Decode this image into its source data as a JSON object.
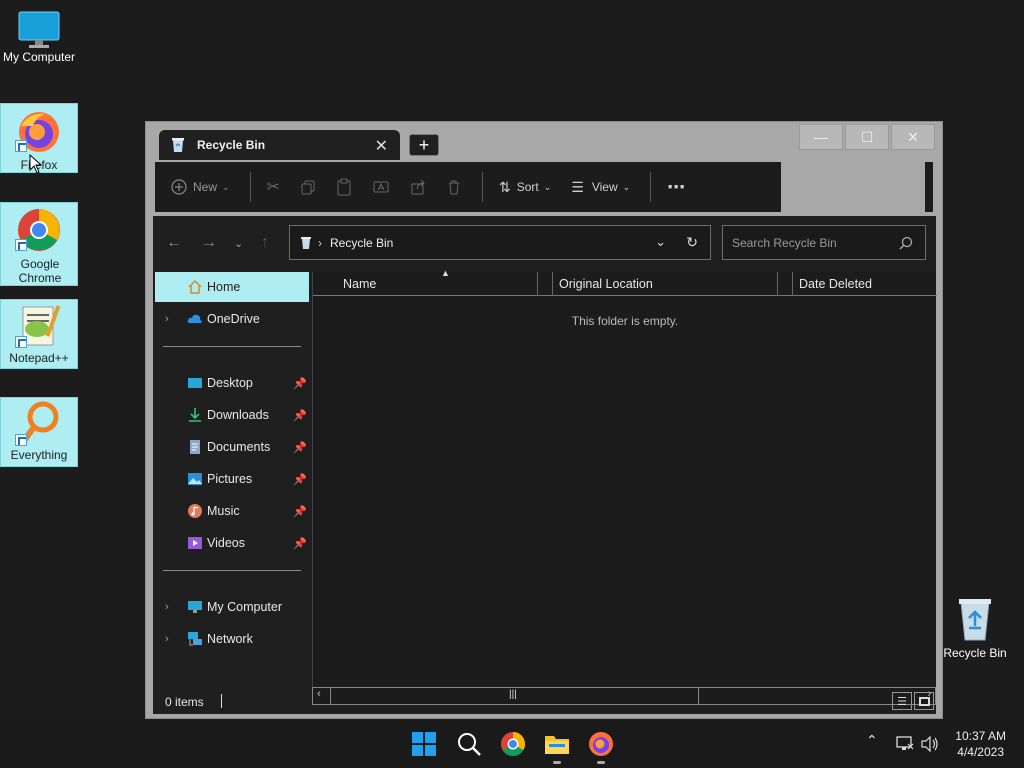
{
  "desktop": {
    "icons": [
      {
        "label": "My Computer"
      },
      {
        "label": "Firefox"
      },
      {
        "label": "Google Chrome"
      },
      {
        "label": "Notepad++"
      },
      {
        "label": "Everything"
      },
      {
        "label": "Recycle Bin"
      }
    ]
  },
  "window": {
    "tab_title": "Recycle Bin",
    "new_tab_label": "+",
    "close_tab_label": "✕",
    "controls": {
      "minimize": "—",
      "maximize": "☐",
      "close": "✕"
    }
  },
  "toolbar": {
    "new_label": "New",
    "sort_label": "Sort",
    "view_label": "View",
    "more_label": "⋯"
  },
  "address": {
    "path_label": "Recycle Bin",
    "search_placeholder": "Search Recycle Bin"
  },
  "sidebar": {
    "items": [
      {
        "label": "Home"
      },
      {
        "label": "OneDrive"
      },
      {
        "label": "Desktop"
      },
      {
        "label": "Downloads"
      },
      {
        "label": "Documents"
      },
      {
        "label": "Pictures"
      },
      {
        "label": "Music"
      },
      {
        "label": "Videos"
      },
      {
        "label": "My Computer"
      },
      {
        "label": "Network"
      }
    ]
  },
  "filepane": {
    "columns": [
      "Name",
      "Original Location",
      "Date Deleted"
    ],
    "empty_text": "This folder is empty."
  },
  "status": {
    "items_count": "0 items"
  },
  "taskbar": {
    "time": "10:37 AM",
    "date": "4/4/2023"
  }
}
